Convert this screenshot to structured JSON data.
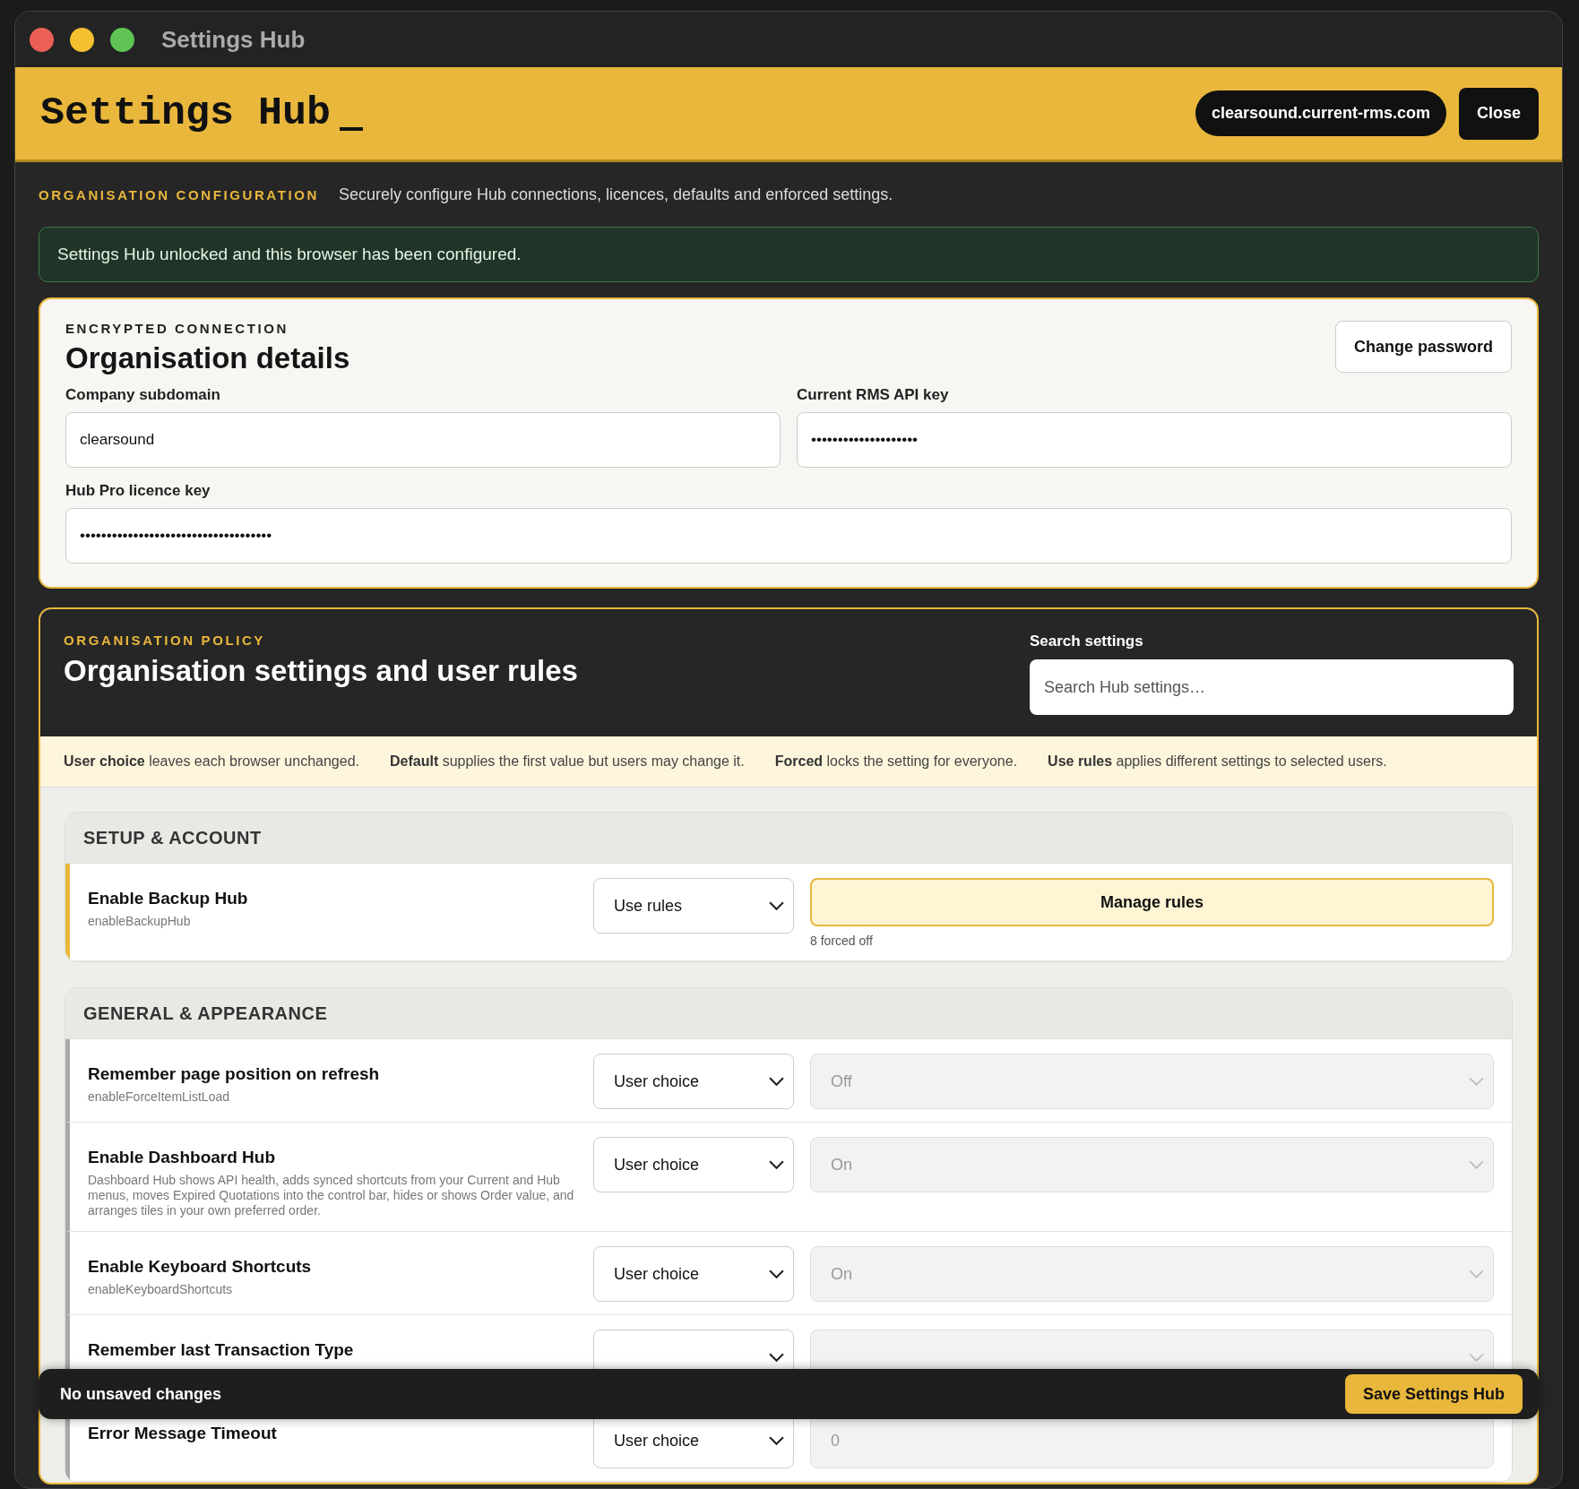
{
  "window": {
    "title": "Settings Hub"
  },
  "header": {
    "title": "Settings Hub",
    "domain": "clearsound.current-rms.com",
    "close": "Close"
  },
  "intro": {
    "eyebrow": "ORGANISATION CONFIGURATION",
    "text": "Securely configure Hub connections, licences, defaults and enforced settings."
  },
  "alert": "Settings Hub unlocked and this browser has been configured.",
  "connection": {
    "eyebrow": "ENCRYPTED CONNECTION",
    "title": "Organisation details",
    "button": "Change password",
    "fields": [
      {
        "label": "Company subdomain",
        "value": "clearsound",
        "wide": false
      },
      {
        "label": "Current RMS API key",
        "value": "••••••••••••••••••••",
        "wide": false
      },
      {
        "label": "Hub Pro licence key",
        "value": "••••••••••••••••••••••••••••••••••••",
        "wide": true
      }
    ]
  },
  "policy": {
    "eyebrow": "ORGANISATION POLICY",
    "title": "Organisation settings and user rules",
    "search_label": "Search settings",
    "search_placeholder": "Search Hub settings…",
    "legend": [
      {
        "term": "User choice",
        "text": "leaves each browser unchanged."
      },
      {
        "term": "Default",
        "text": "supplies the first value but users may change it."
      },
      {
        "term": "Forced",
        "text": "locks the setting for everyone."
      },
      {
        "term": "Use rules",
        "text": "applies different settings to selected users."
      }
    ],
    "sections": [
      {
        "title": "SETUP & ACCOUNT",
        "rows": [
          {
            "kind": "rules",
            "title": "Enable Backup Hub",
            "key": "enableBackupHub",
            "mode": "Use rules",
            "button": "Manage rules",
            "note": "8 forced off"
          }
        ]
      },
      {
        "title": "GENERAL & APPEARANCE",
        "rows": [
          {
            "kind": "select",
            "title": "Remember page position on refresh",
            "key": "enableForceItemListLoad",
            "mode": "User choice",
            "value": "Off",
            "disabled": true
          },
          {
            "kind": "select",
            "title": "Enable Dashboard Hub",
            "key": "Dashboard Hub shows API health, adds synced shortcuts from your Current and Hub menus, moves Expired Quotations into the control bar, hides or shows Order value, and arranges tiles in your own preferred order.",
            "mode": "User choice",
            "value": "On",
            "disabled": true
          },
          {
            "kind": "select",
            "title": "Enable Keyboard Shortcuts",
            "key": "enableKeyboardShortcuts",
            "mode": "User choice",
            "value": "On",
            "disabled": true
          },
          {
            "kind": "select",
            "title": "Remember last Transaction Type",
            "disabled": true
          },
          {
            "kind": "input",
            "title": "Error Message Timeout",
            "mode": "User choice",
            "value": "0",
            "disabled": true
          }
        ]
      }
    ]
  },
  "save_bar": {
    "status": "No unsaved changes",
    "button": "Save Settings Hub"
  }
}
